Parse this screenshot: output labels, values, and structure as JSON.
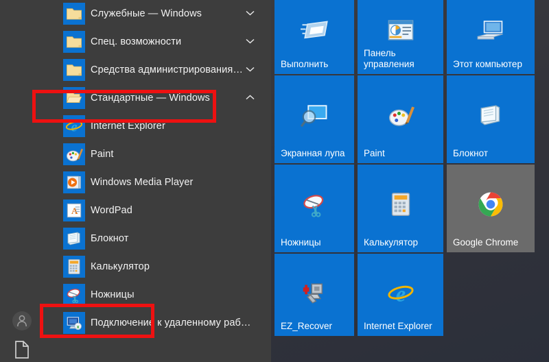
{
  "colors": {
    "menu_background": "#3d3d3d",
    "tile_blue": "#0a72d1",
    "tile_inactive_gray": "#6b6b6b",
    "annotation_red": "#ee1111",
    "text": "#f2f2f2"
  },
  "rail": {
    "avatar_name": "user-avatar",
    "documents_name": "documents-icon"
  },
  "app_list": {
    "items": [
      {
        "label": "Служебные — Windows",
        "icon": "folder-icon",
        "chevron": "⌄",
        "expanded": false,
        "highlighted": false
      },
      {
        "label": "Спец. возможности",
        "icon": "folder-icon",
        "chevron": "⌄",
        "expanded": false,
        "highlighted": false
      },
      {
        "label": "Средства администрирования…",
        "icon": "folder-icon",
        "chevron": "⌄",
        "expanded": false,
        "highlighted": false
      },
      {
        "label": "Стандартные — Windows",
        "icon": "folder-open-icon",
        "chevron": "⌃",
        "expanded": true,
        "highlighted": true
      },
      {
        "label": "Internet Explorer",
        "icon": "internet-explorer-icon",
        "chevron": "",
        "expanded": false,
        "highlighted": false
      },
      {
        "label": "Paint",
        "icon": "paint-icon",
        "chevron": "",
        "expanded": false,
        "highlighted": false
      },
      {
        "label": "Windows Media Player",
        "icon": "windows-media-player-icon",
        "chevron": "",
        "expanded": false,
        "highlighted": false
      },
      {
        "label": "WordPad",
        "icon": "wordpad-icon",
        "chevron": "",
        "expanded": false,
        "highlighted": false
      },
      {
        "label": "Блокнот",
        "icon": "notepad-icon",
        "chevron": "",
        "expanded": false,
        "highlighted": false
      },
      {
        "label": "Калькулятор",
        "icon": "calculator-icon",
        "chevron": "",
        "expanded": false,
        "highlighted": false
      },
      {
        "label": "Ножницы",
        "icon": "snipping-tool-icon",
        "chevron": "",
        "expanded": false,
        "highlighted": true
      },
      {
        "label": "Подключение к удаленному раб…",
        "icon": "remote-desktop-icon",
        "chevron": "",
        "expanded": false,
        "highlighted": false
      }
    ]
  },
  "annotations": [
    {
      "name": "highlight-standard-windows",
      "target": "Стандартные — Windows"
    },
    {
      "name": "highlight-snipping-tool",
      "target": "Ножницы"
    }
  ],
  "tiles": {
    "rows": [
      [
        {
          "label": "Выполнить",
          "icon": "run-dialog-icon",
          "state": "blue"
        },
        {
          "label": "Панель управления",
          "icon": "control-panel-icon",
          "state": "blue"
        },
        {
          "label": "Этот компьютер",
          "icon": "this-pc-icon",
          "state": "blue"
        }
      ],
      [
        {
          "label": "Экранная лупа",
          "icon": "magnifier-icon",
          "state": "blue"
        },
        {
          "label": "Paint",
          "icon": "paint-icon",
          "state": "blue"
        },
        {
          "label": "Блокнот",
          "icon": "notepad-icon",
          "state": "blue"
        }
      ],
      [
        {
          "label": "Ножницы",
          "icon": "snipping-tool-icon",
          "state": "blue"
        },
        {
          "label": "Калькулятор",
          "icon": "calculator-icon",
          "state": "blue"
        },
        {
          "label": "Google Chrome",
          "icon": "google-chrome-icon",
          "state": "gray"
        }
      ],
      [
        {
          "label": "EZ_Recover",
          "icon": "ez-recover-icon",
          "state": "blue"
        },
        {
          "label": "Internet Explorer",
          "icon": "internet-explorer-icon",
          "state": "blue"
        }
      ]
    ]
  }
}
